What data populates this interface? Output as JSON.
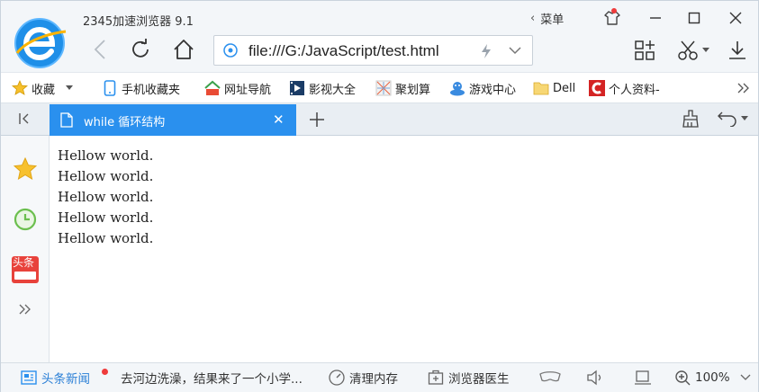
{
  "app": {
    "title": "2345加速浏览器 9.1",
    "menu_label": "菜单"
  },
  "address_bar": {
    "url": "file:///G:/JavaScript/test.html"
  },
  "bookmarks": [
    {
      "label": "收藏",
      "icon": "star-icon"
    },
    {
      "label": "手机收藏夹",
      "icon": "phone-icon"
    },
    {
      "label": "网址导航",
      "icon": "2345-home-icon"
    },
    {
      "label": "影视大全",
      "icon": "film-icon"
    },
    {
      "label": "聚划算",
      "icon": "deal-icon"
    },
    {
      "label": "游戏中心",
      "icon": "game-icon"
    },
    {
      "label": "Dell",
      "icon": "folder-icon"
    },
    {
      "label": "个人资料-",
      "icon": "profile-icon"
    }
  ],
  "tabs": [
    {
      "label": "while 循环结构",
      "active": true
    }
  ],
  "content": {
    "lines": [
      "Hellow world.",
      "Hellow world.",
      "Hellow world.",
      "Hellow world.",
      "Hellow world."
    ]
  },
  "sidebar": {
    "news_badge": "头条"
  },
  "statusbar": {
    "news_label": "头条新闻",
    "headline": "去河边洗澡，结果来了一个小学...",
    "clean_memory": "清理内存",
    "doctor": "浏览器医生",
    "zoom": "100%"
  },
  "colors": {
    "accent": "#2a90ee",
    "logo_blue": "#1f8fe8",
    "notification_red": "#ef3b3b"
  }
}
